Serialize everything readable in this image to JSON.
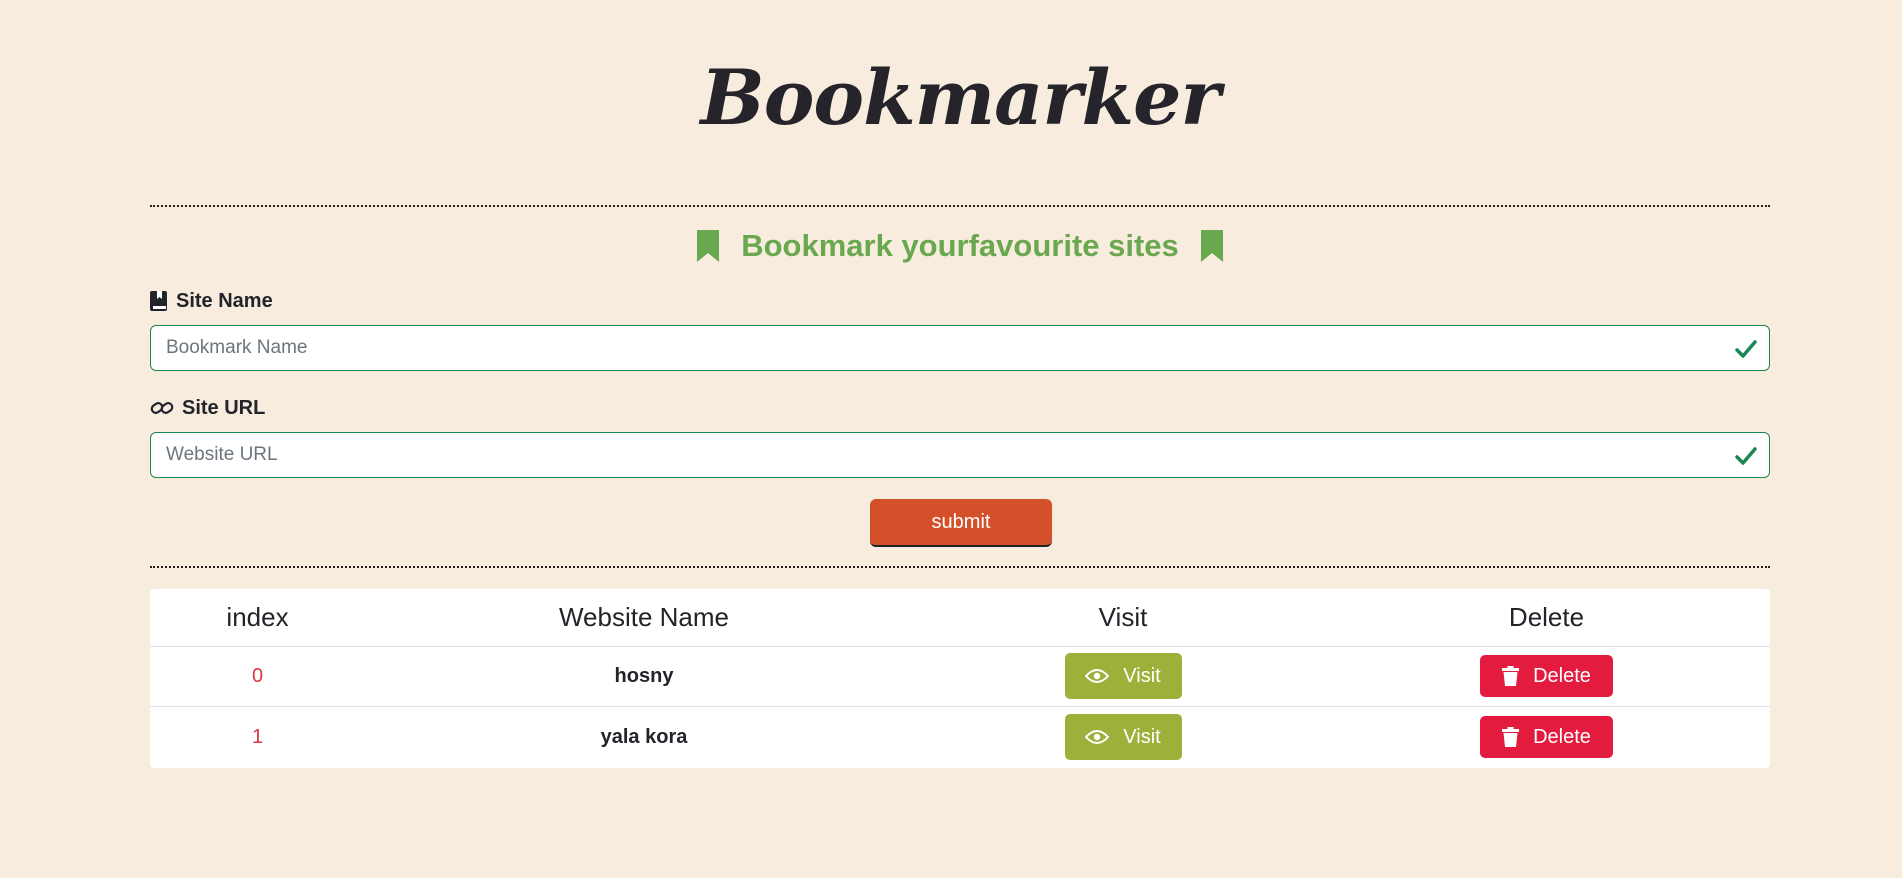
{
  "app": {
    "title": "Bookmarker",
    "subtitle": "Bookmark yourfavourite sites"
  },
  "form": {
    "site_name_label": "Site Name",
    "site_name_placeholder": "Bookmark Name",
    "site_name_value": "",
    "site_url_label": "Site URL",
    "site_url_placeholder": "Website URL",
    "site_url_value": "",
    "submit_label": "submit"
  },
  "table": {
    "headers": [
      "index",
      "Website Name",
      "Visit",
      "Delete"
    ],
    "rows": [
      {
        "index": "0",
        "name": "hosny",
        "visit_label": "Visit",
        "delete_label": "Delete"
      },
      {
        "index": "1",
        "name": "yala kora",
        "visit_label": "Visit",
        "delete_label": "Delete"
      }
    ]
  },
  "icons": {
    "subtitle_left": "bookmark-icon",
    "subtitle_right": "bookmark-icon",
    "site_name": "book-icon",
    "site_url": "link-icon",
    "valid": "check-icon",
    "visit": "eye-icon",
    "delete": "trash-icon"
  },
  "colors": {
    "background": "#f8ecdf",
    "accent_green": "#6aa84f",
    "valid_green": "#198754",
    "submit": "#d4502a",
    "visit": "#9eb03a",
    "delete": "#e31b3f",
    "index_text": "#dc3545"
  }
}
